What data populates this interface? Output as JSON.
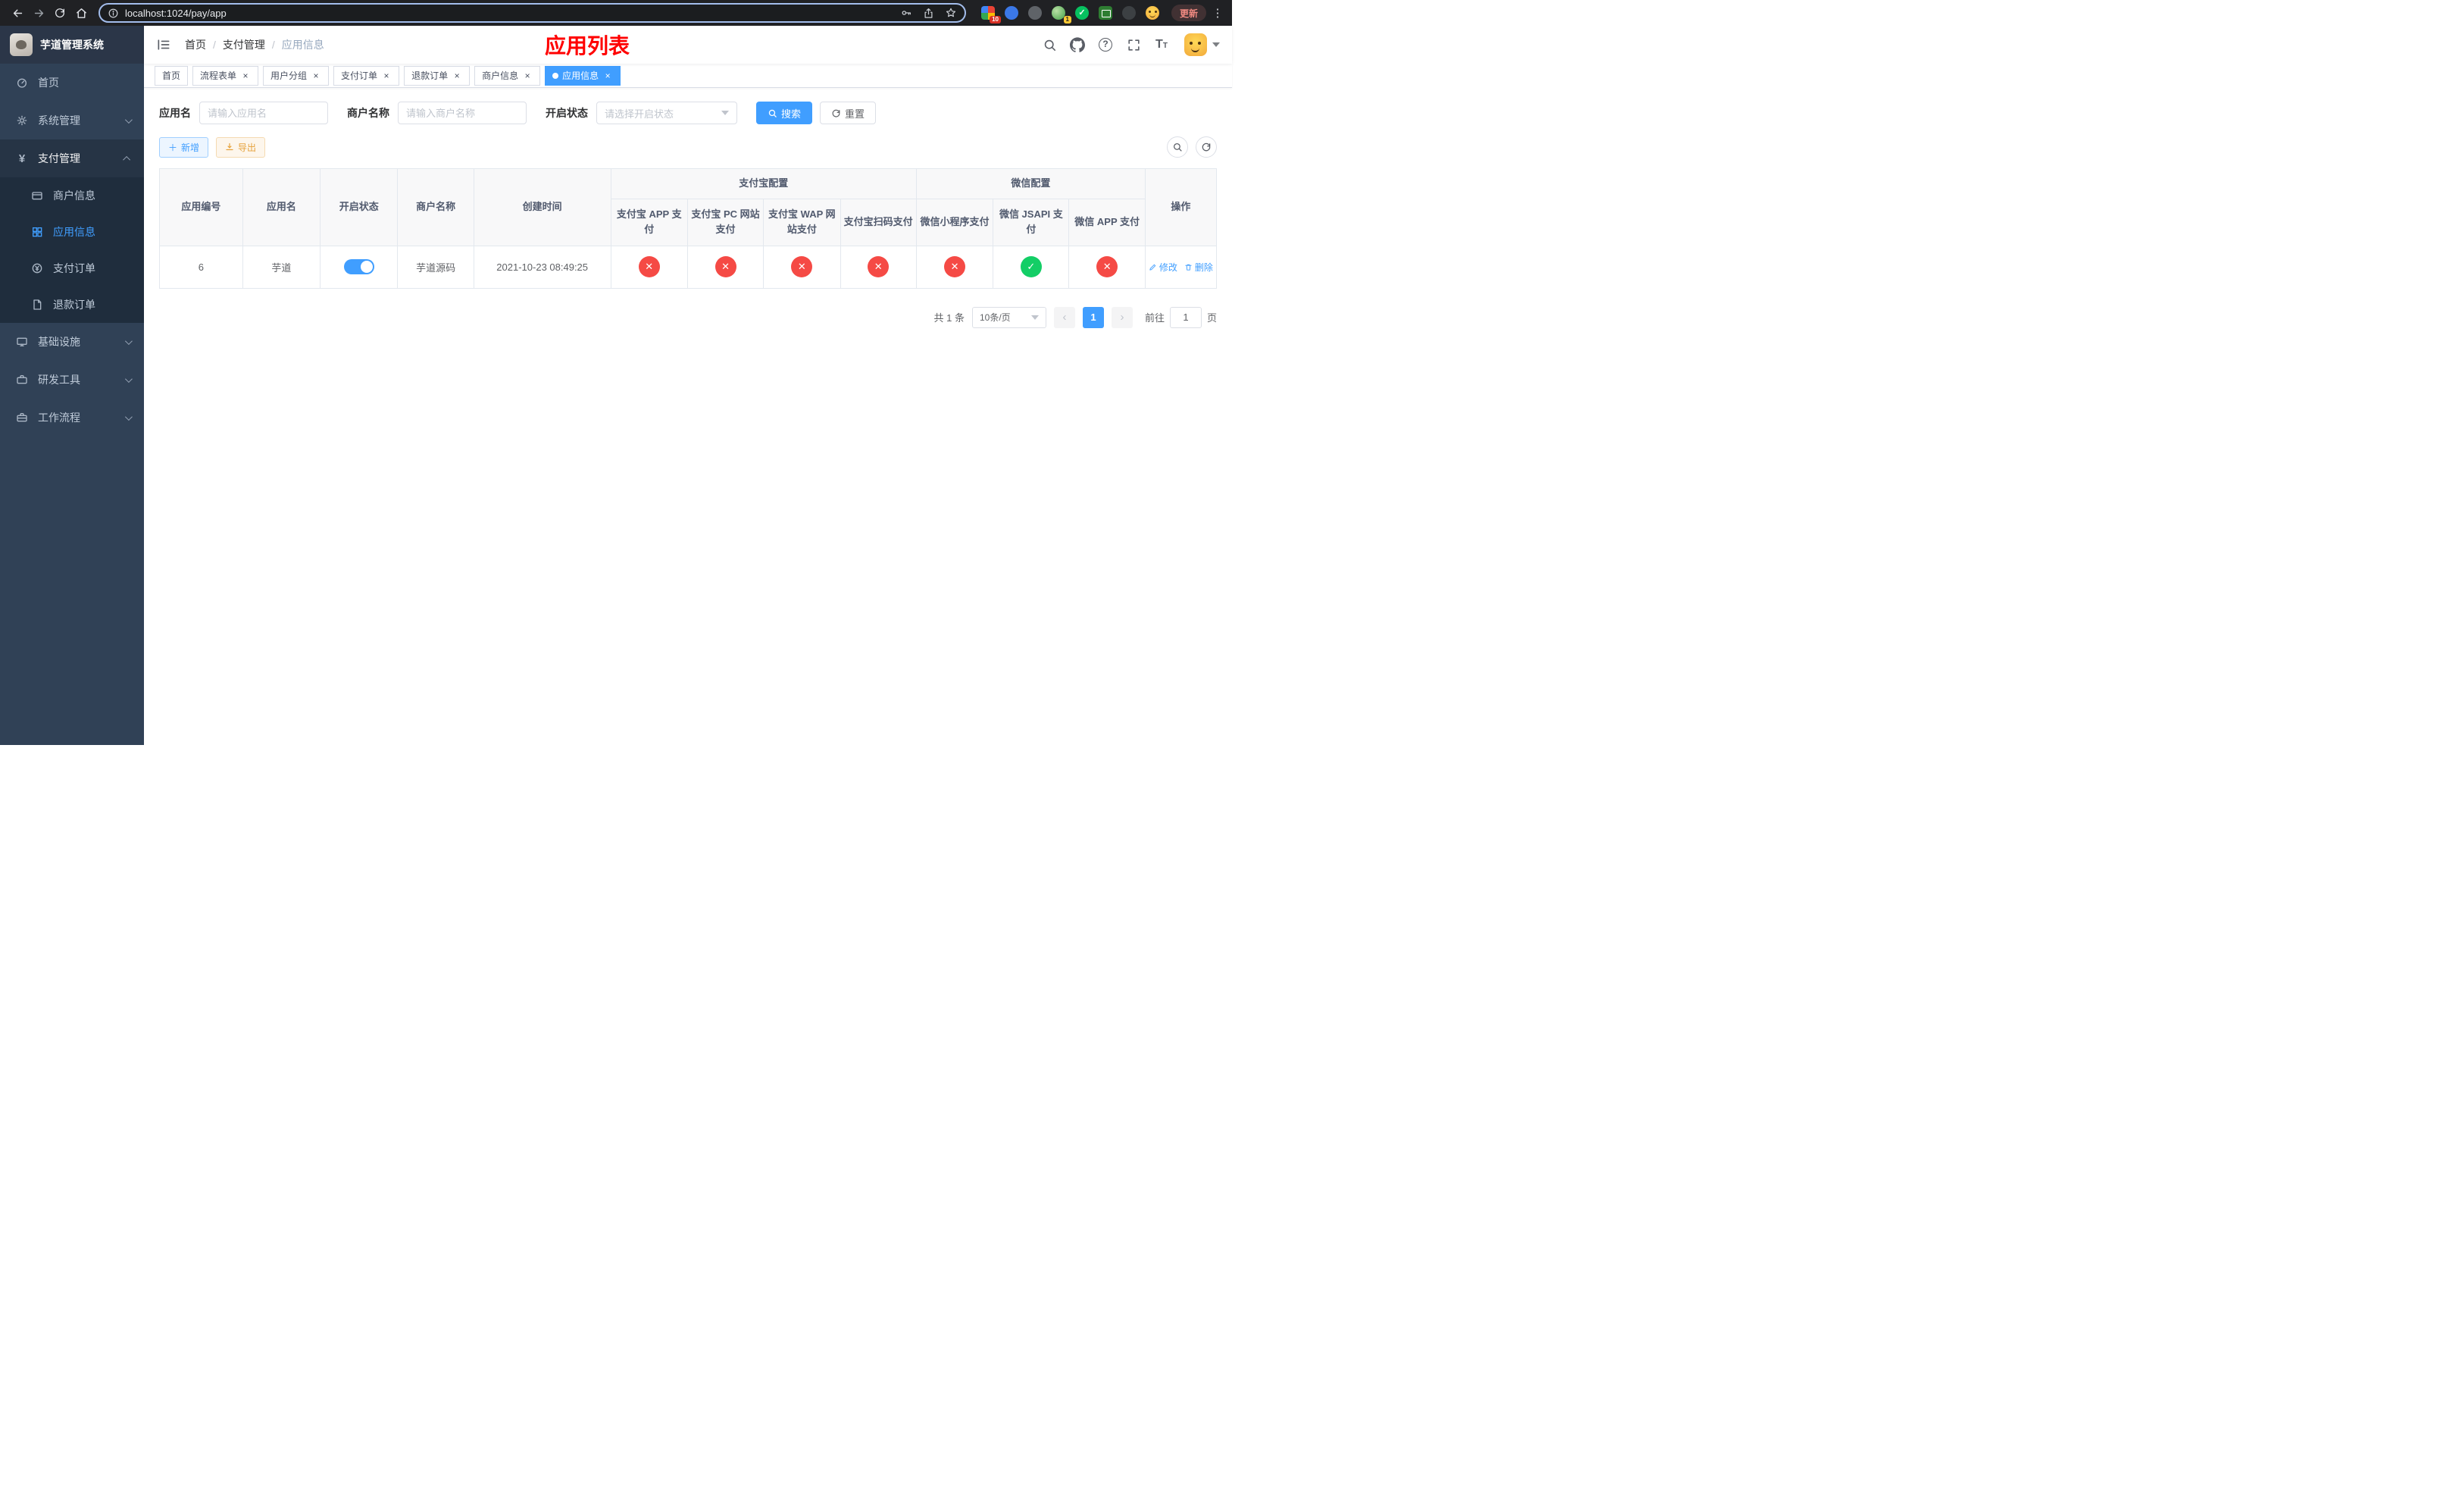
{
  "colors": {
    "accent": "#409eff",
    "success": "#13ce66",
    "danger": "#f54a45",
    "warning": "#e6a23c",
    "title-red": "#ff0000"
  },
  "browser": {
    "url": "localhost:1024/pay/app",
    "update_label": "更新",
    "extension_badge_1": "10",
    "extension_badge_2": "1"
  },
  "sidebar": {
    "title": "芋道管理系统",
    "items": [
      {
        "label": "首页"
      },
      {
        "label": "系统管理"
      },
      {
        "label": "支付管理",
        "children": [
          {
            "label": "商户信息"
          },
          {
            "label": "应用信息"
          },
          {
            "label": "支付订单"
          },
          {
            "label": "退款订单"
          }
        ]
      },
      {
        "label": "基础设施"
      },
      {
        "label": "研发工具"
      },
      {
        "label": "工作流程"
      }
    ]
  },
  "header": {
    "breadcrumb": [
      "首页",
      "支付管理",
      "应用信息"
    ],
    "page_title": "应用列表"
  },
  "tabs": [
    {
      "label": "首页"
    },
    {
      "label": "流程表单"
    },
    {
      "label": "用户分组"
    },
    {
      "label": "支付订单"
    },
    {
      "label": "退款订单"
    },
    {
      "label": "商户信息"
    },
    {
      "label": "应用信息"
    }
  ],
  "filters": {
    "app_name_label": "应用名",
    "app_name_placeholder": "请输入应用名",
    "merchant_label": "商户名称",
    "merchant_placeholder": "请输入商户名称",
    "status_label": "开启状态",
    "status_placeholder": "请选择开启状态",
    "search_button": "搜索",
    "reset_button": "重置"
  },
  "toolbar": {
    "add_button": "新增",
    "export_button": "导出"
  },
  "table": {
    "columns": {
      "app_id": "应用编号",
      "app_name": "应用名",
      "enabled": "开启状态",
      "merchant_name": "商户名称",
      "create_time": "创建时间",
      "alipay_group": "支付宝配置",
      "wechat_group": "微信配置",
      "alipay_app": "支付宝 APP 支付",
      "alipay_pc": "支付宝 PC 网站支付",
      "alipay_wap": "支付宝 WAP 网站支付",
      "alipay_qr": "支付宝扫码支付",
      "wechat_mini": "微信小程序支付",
      "wechat_jsapi": "微信 JSAPI 支付",
      "wechat_app": "微信 APP 支付",
      "actions": "操作"
    },
    "rows": [
      {
        "app_id": "6",
        "app_name": "芋道",
        "enabled": true,
        "merchant_name": "芋道源码",
        "create_time": "2021-10-23 08:49:25",
        "alipay_app": false,
        "alipay_pc": false,
        "alipay_wap": false,
        "alipay_qr": false,
        "wechat_mini": false,
        "wechat_jsapi": true,
        "wechat_app": false,
        "edit_label": "修改",
        "delete_label": "删除"
      }
    ]
  },
  "pagination": {
    "total_label": "共 1 条",
    "page_size_label": "10条/页",
    "current_page": "1",
    "goto_label": "前往",
    "goto_value": "1",
    "page_unit": "页"
  }
}
